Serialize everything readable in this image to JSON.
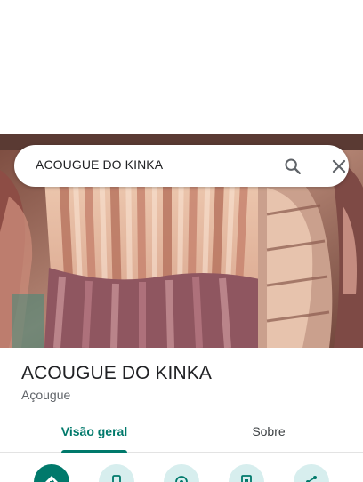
{
  "search": {
    "query": "ACOUGUE DO KINKA",
    "search_icon": "search-icon",
    "close_icon": "close-icon"
  },
  "place": {
    "name": "ACOUGUE DO KINKA",
    "category": "Açougue",
    "photo": "meat-carcass-photo"
  },
  "tabs": [
    {
      "label": "Visão geral",
      "selected": true
    },
    {
      "label": "Sobre",
      "selected": false
    }
  ],
  "actions": [
    {
      "icon": "directions-icon",
      "primary": true
    },
    {
      "icon": "phone-icon",
      "primary": false
    },
    {
      "icon": "location-pin-icon",
      "primary": false
    },
    {
      "icon": "save-icon",
      "primary": false
    },
    {
      "icon": "share-icon",
      "primary": false
    }
  ],
  "colors": {
    "accent": "#00796b",
    "action_bg": "#d7eeee",
    "title_text": "#202124",
    "secondary_text": "#5f6368"
  }
}
